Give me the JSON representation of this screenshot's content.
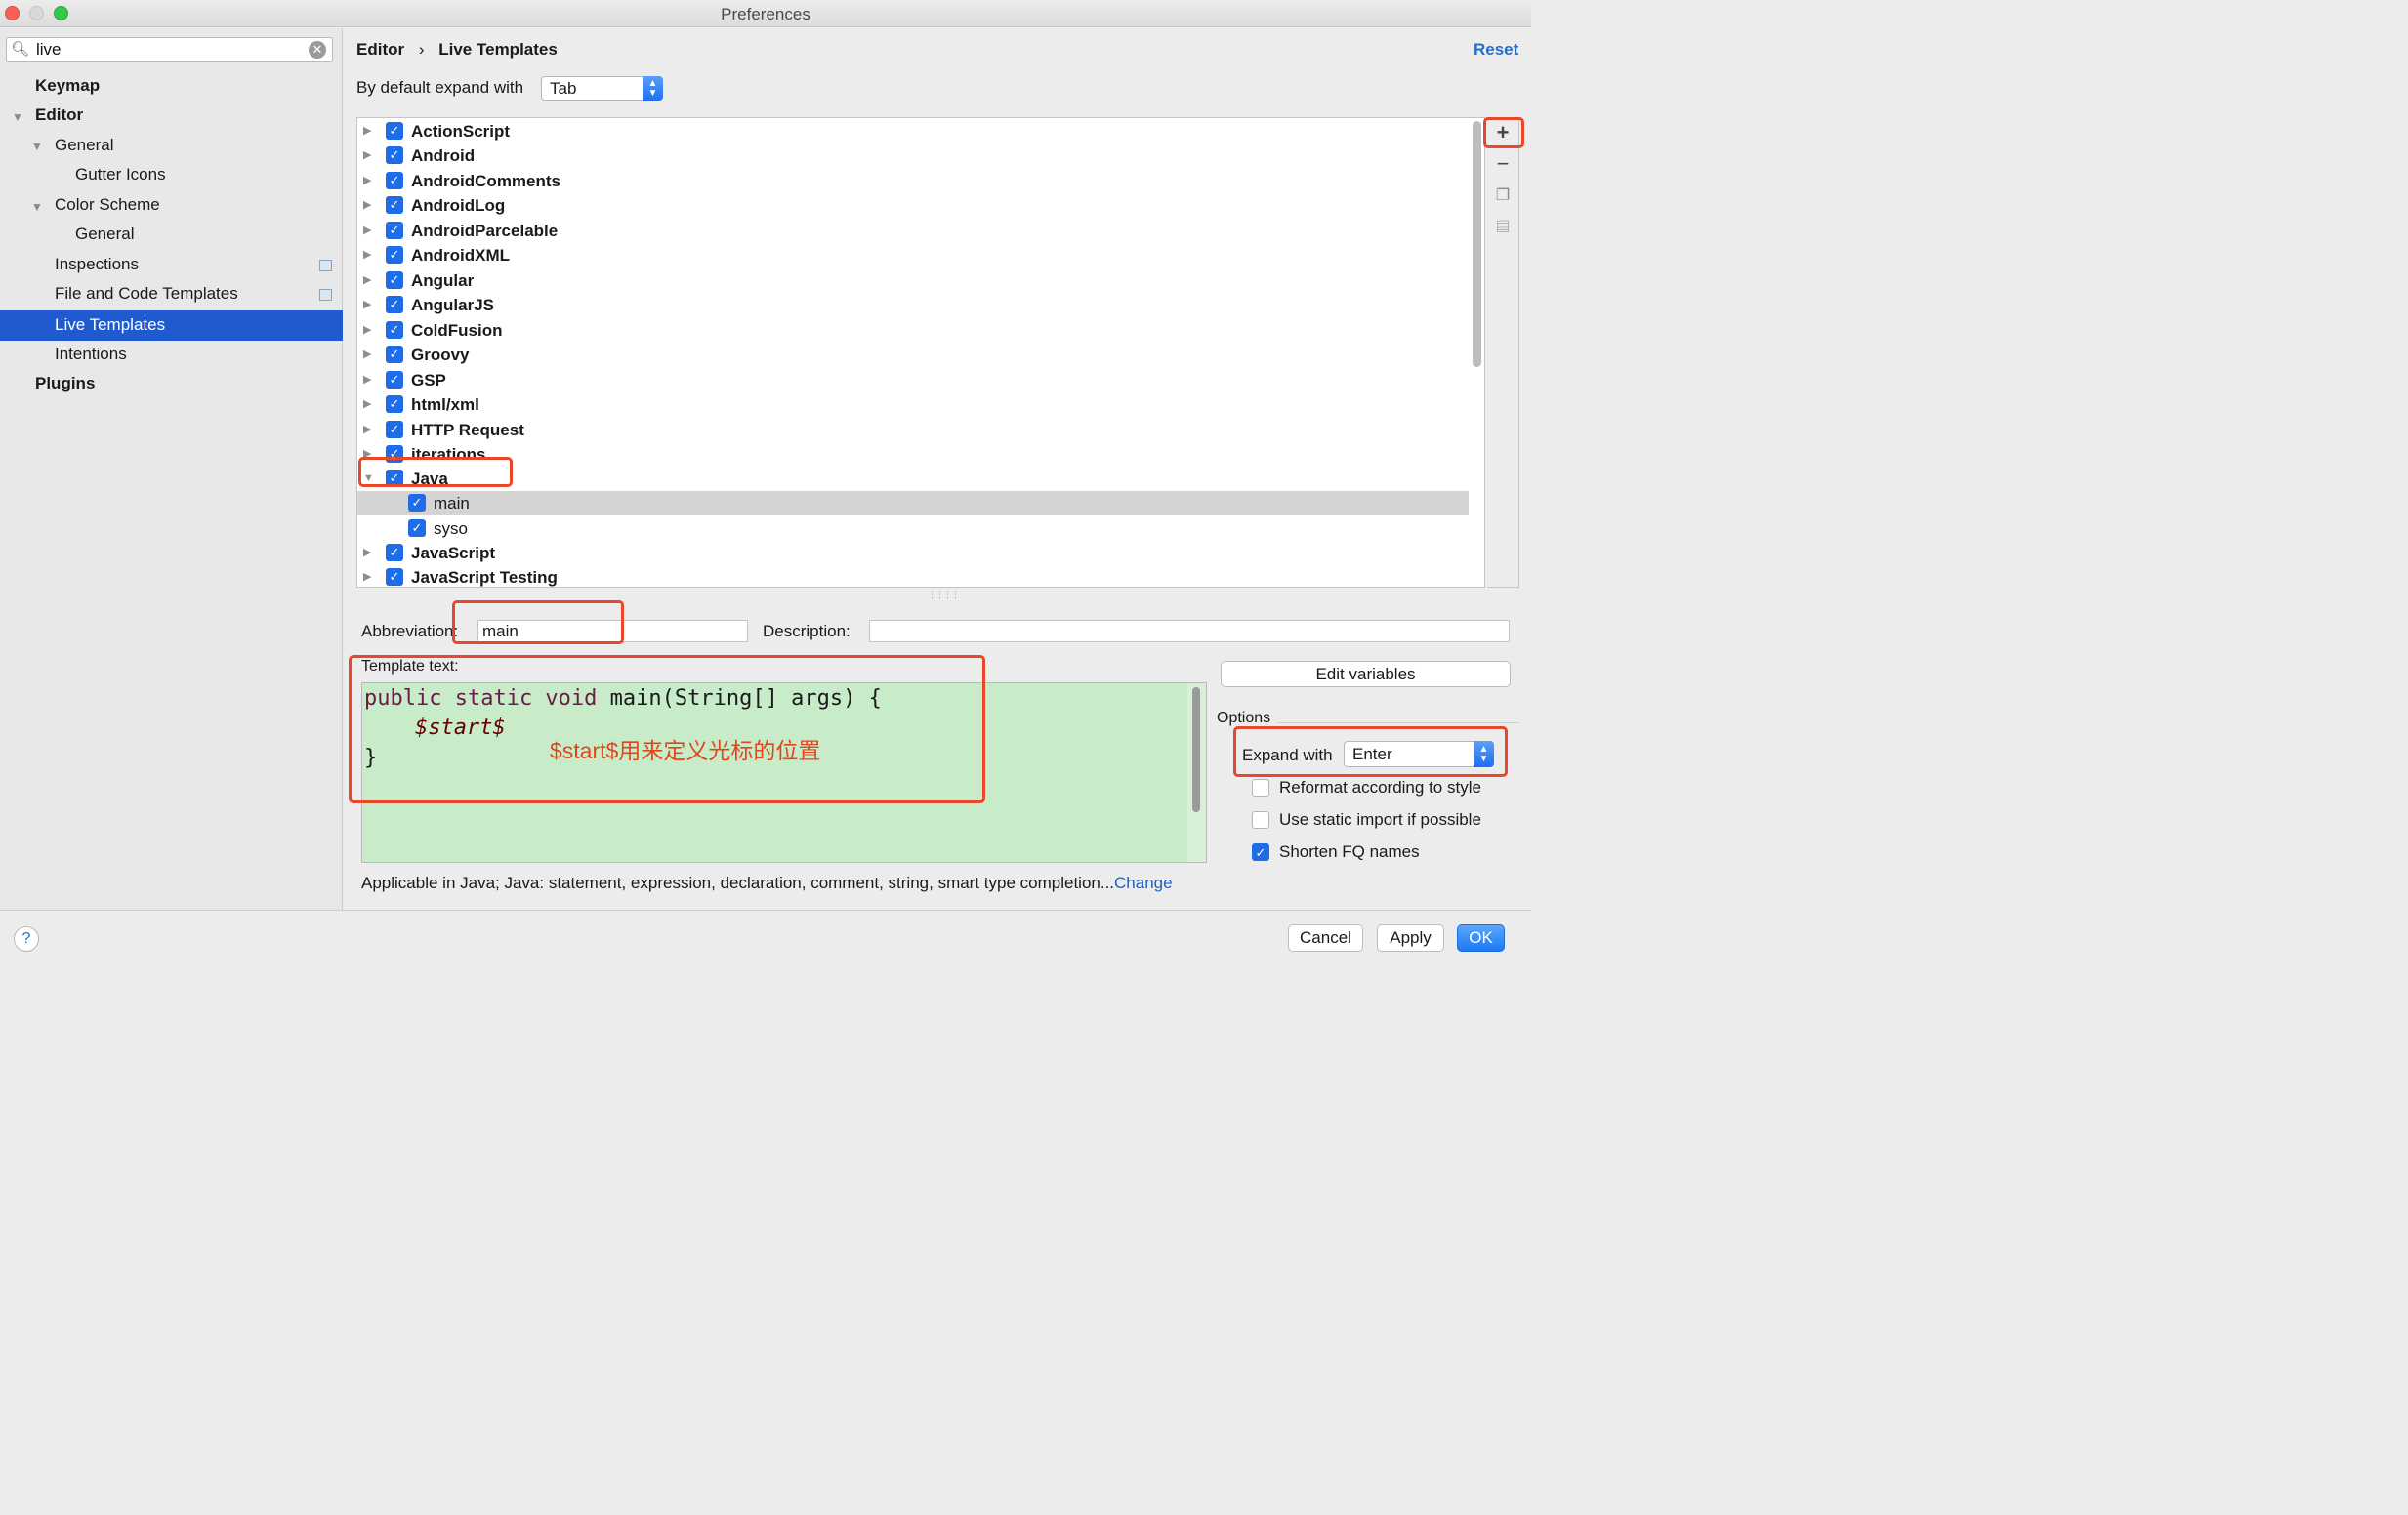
{
  "window": {
    "title": "Preferences"
  },
  "sidebar": {
    "search_value": "live",
    "items": [
      {
        "label": "Keymap"
      },
      {
        "label": "Editor"
      },
      {
        "label": "General"
      },
      {
        "label": "Gutter Icons"
      },
      {
        "label": "Color Scheme"
      },
      {
        "label": "General"
      },
      {
        "label": "Inspections"
      },
      {
        "label": "File and Code Templates"
      },
      {
        "label": "Live Templates"
      },
      {
        "label": "Intentions"
      },
      {
        "label": "Plugins"
      }
    ]
  },
  "header": {
    "breadcrumb_parent": "Editor",
    "breadcrumb_sep": "›",
    "breadcrumb_current": "Live Templates",
    "reset_label": "Reset"
  },
  "expand_default": {
    "label": "By default expand with",
    "value": "Tab"
  },
  "templates": {
    "groups": [
      {
        "name": "ActionScript",
        "checked": true
      },
      {
        "name": "Android",
        "checked": true
      },
      {
        "name": "AndroidComments",
        "checked": true
      },
      {
        "name": "AndroidLog",
        "checked": true
      },
      {
        "name": "AndroidParcelable",
        "checked": true
      },
      {
        "name": "AndroidXML",
        "checked": true
      },
      {
        "name": "Angular",
        "checked": true
      },
      {
        "name": "AngularJS",
        "checked": true
      },
      {
        "name": "ColdFusion",
        "checked": true
      },
      {
        "name": "Groovy",
        "checked": true
      },
      {
        "name": "GSP",
        "checked": true
      },
      {
        "name": "html/xml",
        "checked": true
      },
      {
        "name": "HTTP Request",
        "checked": true
      },
      {
        "name": "iterations",
        "checked": true
      },
      {
        "name": "Java",
        "checked": true,
        "expanded": true
      },
      {
        "name": "main",
        "checked": true,
        "selected": true
      },
      {
        "name": "syso",
        "checked": true
      },
      {
        "name": "JavaScript",
        "checked": true
      },
      {
        "name": "JavaScript Testing",
        "checked": true
      }
    ],
    "toolbar_icons": [
      "add-icon",
      "remove-icon",
      "copy-icon",
      "restore-icon"
    ]
  },
  "detail": {
    "abbreviation_label": "Abbreviation:",
    "abbreviation_value": "main",
    "description_label": "Description:",
    "description_value": "",
    "template_text_label": "Template text:",
    "code_line1_keyword": "public static void",
    "code_line1_rest": " main(String[] args) {",
    "code_line2_var": "$start$",
    "code_line3": "}",
    "annotation": "$start$用来定义光标的位置",
    "applicable_text": "Applicable in Java; Java: statement, expression, declaration, comment, string, smart type completion...",
    "change_link": "Change"
  },
  "options": {
    "edit_variables_label": "Edit variables",
    "title": "Options",
    "expand_with_label": "Expand with",
    "expand_with_value": "Enter",
    "reformat_label": "Reformat according to style",
    "reformat_checked": false,
    "static_import_label": "Use static import if possible",
    "static_import_checked": false,
    "shorten_fq_label": "Shorten FQ names",
    "shorten_fq_checked": true
  },
  "footer": {
    "help_label": "?",
    "cancel_label": "Cancel",
    "apply_label": "Apply",
    "ok_label": "OK"
  },
  "colors": {
    "selection": "#1f5bce",
    "accent": "#1f6ce9",
    "annotation_red": "#e8472a",
    "editor_bg": "#c8ecc9",
    "link": "#1e60c8"
  }
}
